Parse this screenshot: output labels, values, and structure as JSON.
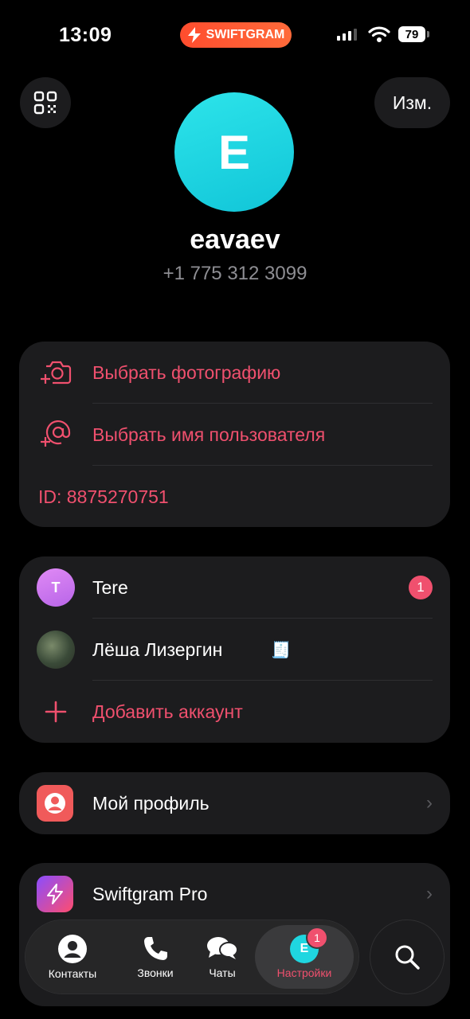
{
  "status_bar": {
    "time": "13:09",
    "badge": "SWIFTGRAM",
    "battery": "79"
  },
  "header": {
    "edit_label": "Изм."
  },
  "profile": {
    "avatar_letter": "E",
    "name": "eavaev",
    "phone": "+1 775 312 3099"
  },
  "profile_actions": {
    "choose_photo": "Выбрать фотографию",
    "choose_username": "Выбрать имя пользователя",
    "id_text": "ID: 8875270751"
  },
  "accounts": {
    "items": [
      {
        "avatar_letter": "T",
        "name": "Tere",
        "unread": "1"
      },
      {
        "name": "Лёша Лизергин"
      }
    ],
    "add_label": "Добавить аккаунт"
  },
  "menu": {
    "my_profile": "Мой профиль",
    "swiftgram_pro": "Swiftgram Pro"
  },
  "tabbar": {
    "contacts": "Контакты",
    "calls": "Звонки",
    "chats": "Чаты",
    "settings": "Настройки",
    "settings_avatar_letter": "E",
    "settings_badge": "1"
  },
  "colors": {
    "accent": "#f0506e",
    "avatar": "#1fd6e0",
    "background": "#000000",
    "card": "#1c1c1e"
  }
}
